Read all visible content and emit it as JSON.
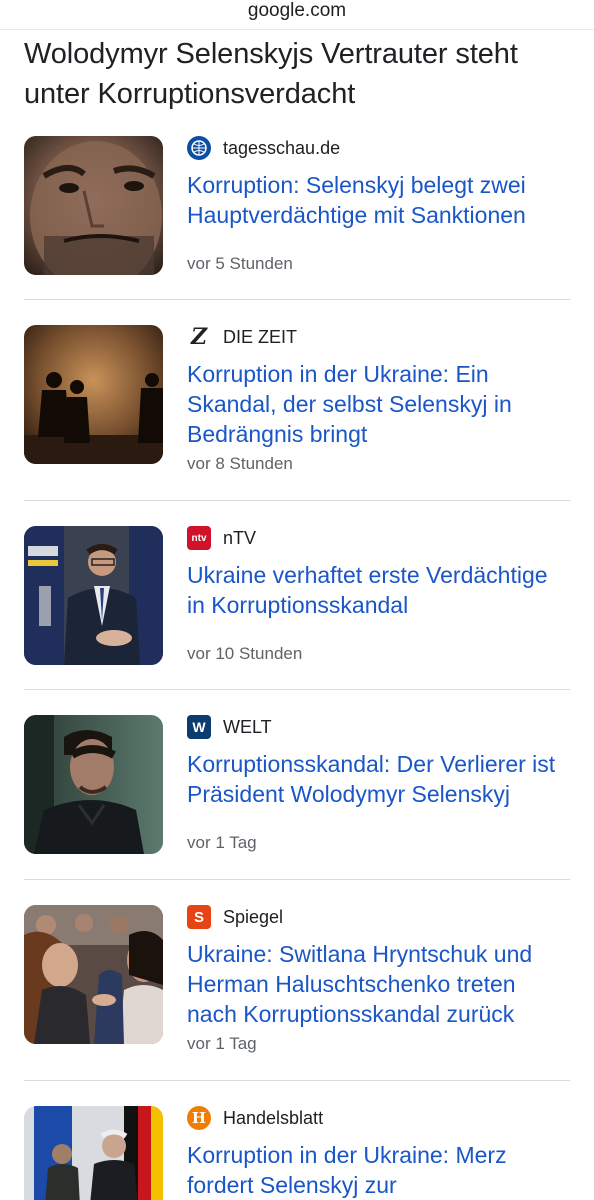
{
  "browser": {
    "url": "google.com"
  },
  "headline": "Wolodymyr Selenskyjs Vertrauter steht unter Korruptionsverdacht",
  "articles": [
    {
      "source": "tagesschau.de",
      "source_icon": "tagesschau-logo",
      "title": "Korruption: Selenskyj belegt zwei Hauptverdächtige mit Sanktionen",
      "time": "vor 5 Stunden"
    },
    {
      "source": "DIE ZEIT",
      "source_icon": "zeit-logo",
      "logo_text": "Z",
      "title": "Korruption in der Ukraine: Ein Skandal, der selbst Selenskyj in Bedrängnis bringt",
      "time": "vor 8 Stunden"
    },
    {
      "source": "nTV",
      "source_icon": "ntv-logo",
      "logo_text": "ntv",
      "title": "Ukraine verhaftet erste Verdächtige in Korruptionsskandal",
      "time": "vor 10 Stunden"
    },
    {
      "source": "WELT",
      "source_icon": "welt-logo",
      "logo_text": "W",
      "title": "Korruptionsskandal: Der Verlierer ist Präsident Wolodymyr Selenskyj",
      "time": "vor 1 Tag"
    },
    {
      "source": "Spiegel",
      "source_icon": "spiegel-logo",
      "logo_text": "S",
      "title": "Ukraine: Switlana Hryntschuk und Herman Haluschtschenko treten nach Korruptionsskandal zurück",
      "time": "vor 1 Tag"
    },
    {
      "source": "Handelsblatt",
      "source_icon": "handelsblatt-logo",
      "logo_text": "H",
      "title": "Korruption in der Ukraine: Merz fordert Selenskyj zur",
      "time": ""
    }
  ],
  "colors": {
    "link": "#1a56c7",
    "text": "#202124",
    "muted": "#5f6368",
    "divider": "#dadce0",
    "tagesschau": "#0b4ea2",
    "ntv": "#d0122a",
    "welt": "#0c3b6e",
    "spiegel": "#e64415",
    "handelsblatt": "#f07d00"
  }
}
